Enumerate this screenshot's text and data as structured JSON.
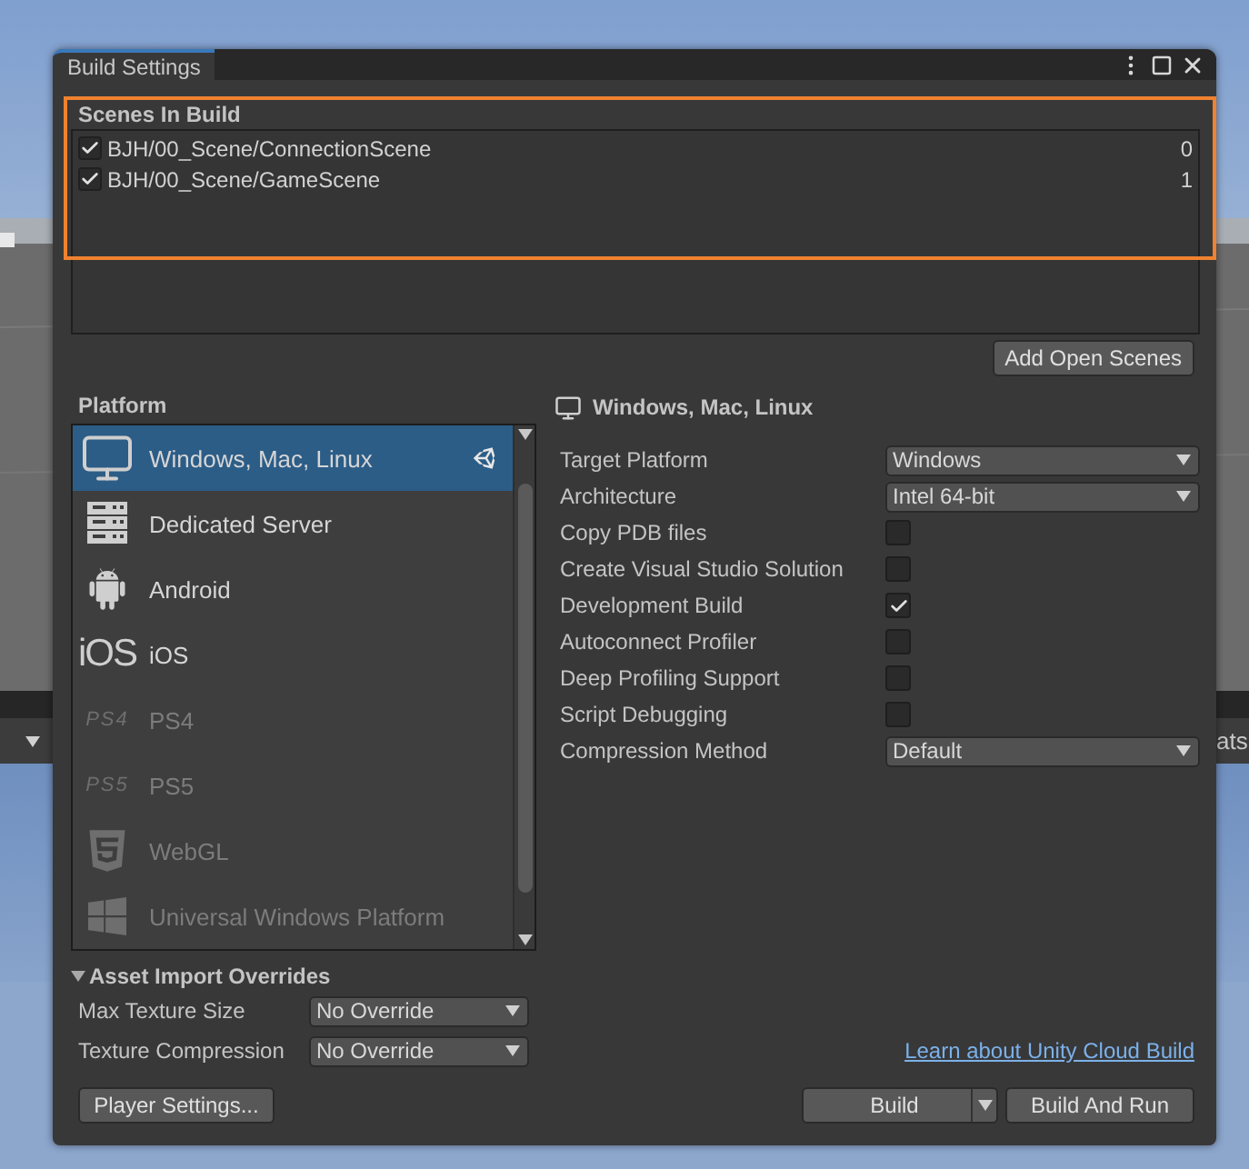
{
  "background": {
    "toolbar_text": "ats"
  },
  "window": {
    "tabs": [
      {
        "label": "Build Settings",
        "selected": true
      }
    ]
  },
  "scenes_in_build": {
    "label": "Scenes In Build",
    "highlighted": true,
    "scenes": [
      {
        "path": "BJH/00_Scene/ConnectionScene",
        "index": "0",
        "checked": true
      },
      {
        "path": "BJH/00_Scene/GameScene",
        "index": "1",
        "checked": true
      }
    ],
    "add_button": "Add Open Scenes"
  },
  "platform": {
    "label": "Platform",
    "items": [
      {
        "kind": "desktop",
        "name": "Windows, Mac, Linux",
        "selected": true,
        "disabled": false,
        "active": true
      },
      {
        "kind": "server",
        "name": "Dedicated Server",
        "selected": false,
        "disabled": false,
        "active": false
      },
      {
        "kind": "android",
        "name": "Android",
        "selected": false,
        "disabled": false,
        "active": false
      },
      {
        "kind": "ios",
        "logo_text": "iOS",
        "name": "iOS",
        "selected": false,
        "disabled": false,
        "active": false
      },
      {
        "kind": "playstation",
        "logo_text": "PS4",
        "name": "PS4",
        "selected": false,
        "disabled": true,
        "active": false
      },
      {
        "kind": "playstation",
        "logo_text": "PS5",
        "name": "PS5",
        "selected": false,
        "disabled": true,
        "active": false
      },
      {
        "kind": "html5",
        "name": "WebGL",
        "selected": false,
        "disabled": true,
        "active": false
      },
      {
        "kind": "windows",
        "name": "Universal Windows Platform",
        "selected": false,
        "disabled": true,
        "active": false
      }
    ]
  },
  "settings": {
    "title": "Windows, Mac, Linux",
    "rows": [
      {
        "kind": "dropdown",
        "label": "Target Platform",
        "value": "Windows"
      },
      {
        "kind": "dropdown",
        "label": "Architecture",
        "value": "Intel 64-bit"
      },
      {
        "kind": "checkbox",
        "label": "Copy PDB files",
        "checked": false
      },
      {
        "kind": "checkbox",
        "label": "Create Visual Studio Solution",
        "checked": false
      },
      {
        "kind": "checkbox",
        "label": "Development Build",
        "checked": true
      },
      {
        "kind": "checkbox",
        "label": "Autoconnect Profiler",
        "checked": false
      },
      {
        "kind": "checkbox",
        "label": "Deep Profiling Support",
        "checked": false
      },
      {
        "kind": "checkbox",
        "label": "Script Debugging",
        "checked": false
      },
      {
        "kind": "dropdown",
        "label": "Compression Method",
        "value": "Default"
      }
    ]
  },
  "asset_import_overrides": {
    "label": "Asset Import Overrides",
    "expanded": true,
    "rows": [
      {
        "label": "Max Texture Size",
        "value": "No Override"
      },
      {
        "label": "Texture Compression",
        "value": "No Override"
      }
    ]
  },
  "cloud_build_link": "Learn about Unity Cloud Build",
  "buttons": {
    "player_settings": "Player Settings...",
    "build": "Build",
    "build_and_run": "Build And Run"
  }
}
